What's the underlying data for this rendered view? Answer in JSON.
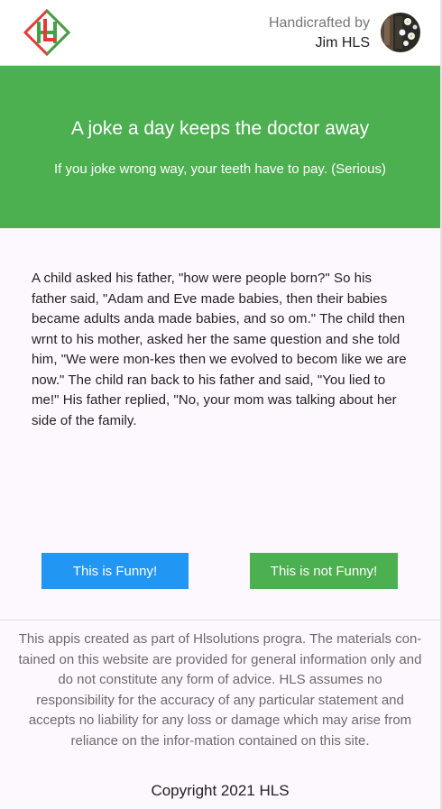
{
  "header": {
    "logo_icon": "hl-diamond-logo",
    "credit_label": "Handicrafted by",
    "author": "Jim HLS",
    "avatar_icon": "avatar-photo"
  },
  "hero": {
    "title": "A joke a day keeps the doctor away",
    "subtitle": "If you joke wrong way, your teeth have to pay. (Serious)",
    "color": "#4caf50"
  },
  "joke": {
    "text": "A child asked his father, \"how were people born?\" So his father said, \"Adam and Eve made babies, then their babies became adults anda made babies, and so om.\" The child then wrnt to his mother, asked her the same question and she told him, \"We were mon-kes then we evolved to becom like we are now.\" The child ran back to his father and said, \"You lied to me!\" His father replied, \"No, your mom was talking about her side of the family."
  },
  "buttons": {
    "funny": {
      "label": "This is Funny!",
      "color": "#2196f3"
    },
    "not_funny": {
      "label": "This is not Funny!",
      "color": "#4caf50"
    }
  },
  "footer": {
    "disclaimer": "This appis created as part of Hlsolutions progra. The materials con-tained on this website are provided for general information only and do not constitute any form of advice. HLS assumes no responsibility for the accuracy of any particular statement and accepts no liability for any loss or damage which may arise from reliance on the infor-mation contained on this site.",
    "copyright": "Copyright 2021 HLS"
  }
}
